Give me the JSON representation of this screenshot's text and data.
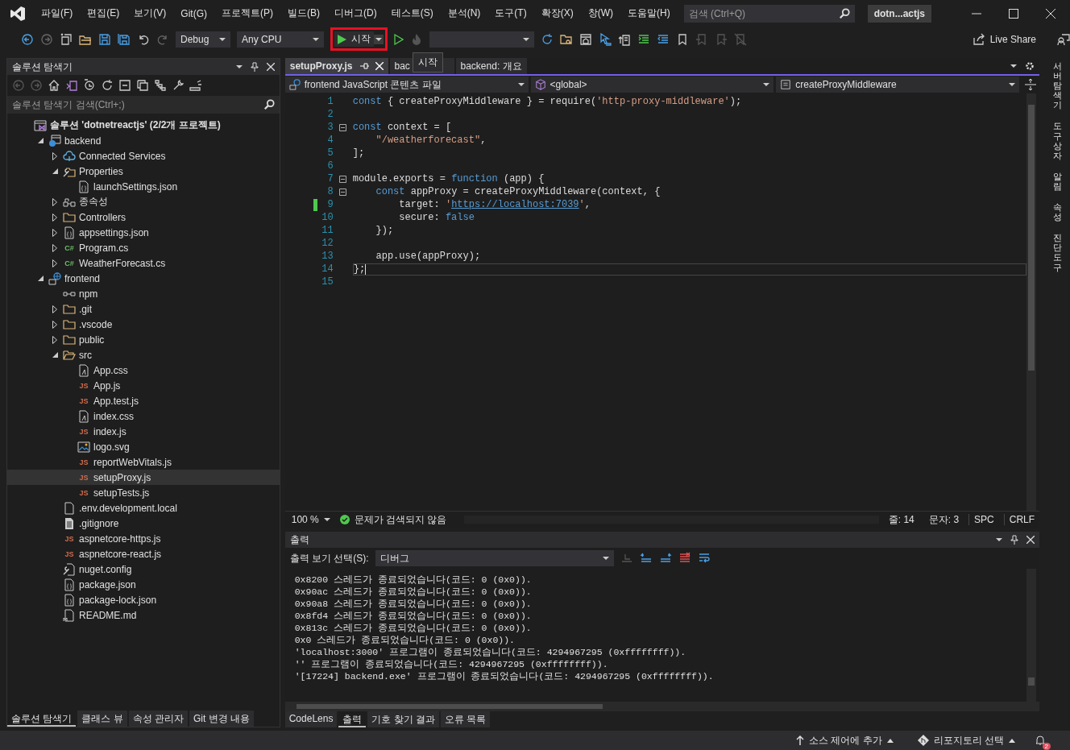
{
  "menu": [
    "파일(F)",
    "편집(E)",
    "보기(V)",
    "Git(G)",
    "프로젝트(P)",
    "빌드(B)",
    "디버그(D)",
    "테스트(S)",
    "분석(N)",
    "도구(T)",
    "확장(X)",
    "창(W)",
    "도움말(H)"
  ],
  "search": {
    "placeholder": "검색 (Ctrl+Q)"
  },
  "solution_name": "dotn...actjs",
  "toolbar": {
    "configuration": "Debug",
    "platform": "Any CPU",
    "start": {
      "label": "시작",
      "highlighted": true
    },
    "live_share": "Live Share"
  },
  "tooltip": "시작",
  "solution_explorer": {
    "title": "솔루션 탐색기",
    "search": {
      "placeholder": "솔루션 탐색기 검색(Ctrl+;)"
    },
    "tree": [
      {
        "label": "솔루션 'dotnetreactjs' (2/2개 프로젝트)",
        "kind": "solution",
        "bold": true,
        "selected": false,
        "children": [
          {
            "label": "backend",
            "kind": "project",
            "expanded": true,
            "selected": false,
            "children": [
              {
                "label": "Connected Services",
                "kind": "cloud",
                "expanded": false,
                "selected": false
              },
              {
                "label": "Properties",
                "kind": "properties",
                "expanded": true,
                "selected": false,
                "children": [
                  {
                    "label": "launchSettings.json",
                    "kind": "json",
                    "selected": false
                  }
                ]
              },
              {
                "label": "종속성",
                "kind": "deps",
                "expanded": false,
                "selected": false
              },
              {
                "label": "Controllers",
                "kind": "folder",
                "expanded": false,
                "selected": false
              },
              {
                "label": "appsettings.json",
                "kind": "json",
                "expanded": false,
                "selected": false
              },
              {
                "label": "Program.cs",
                "kind": "code",
                "badge": "C#",
                "expanded": false,
                "selected": false
              },
              {
                "label": "WeatherForecast.cs",
                "kind": "code",
                "badge": "C#",
                "expanded": false,
                "selected": false
              }
            ]
          },
          {
            "label": "frontend",
            "kind": "web",
            "expanded": true,
            "selected": false,
            "children": [
              {
                "label": "npm",
                "kind": "npm",
                "selected": false
              },
              {
                "label": ".git",
                "kind": "folder",
                "expanded": false,
                "selected": false
              },
              {
                "label": ".vscode",
                "kind": "folder",
                "expanded": false,
                "selected": false
              },
              {
                "label": "public",
                "kind": "folder",
                "expanded": false,
                "selected": false
              },
              {
                "label": "src",
                "kind": "folder",
                "expanded": true,
                "selected": false,
                "children": [
                  {
                    "label": "App.css",
                    "kind": "css",
                    "selected": false
                  },
                  {
                    "label": "App.js",
                    "kind": "code",
                    "badge": "JS",
                    "selected": false
                  },
                  {
                    "label": "App.test.js",
                    "kind": "code",
                    "badge": "JS",
                    "selected": false
                  },
                  {
                    "label": "index.css",
                    "kind": "css",
                    "selected": false
                  },
                  {
                    "label": "index.js",
                    "kind": "code",
                    "badge": "JS",
                    "selected": false
                  },
                  {
                    "label": "logo.svg",
                    "kind": "image",
                    "selected": false
                  },
                  {
                    "label": "reportWebVitals.js",
                    "kind": "code",
                    "badge": "JS",
                    "selected": false
                  },
                  {
                    "label": "setupProxy.js",
                    "kind": "code",
                    "badge": "JS",
                    "selected": true
                  },
                  {
                    "label": "setupTests.js",
                    "kind": "code",
                    "badge": "JS",
                    "selected": false
                  }
                ]
              },
              {
                "label": ".env.development.local",
                "kind": "file",
                "selected": false
              },
              {
                "label": ".gitignore",
                "kind": "text",
                "selected": false
              },
              {
                "label": "aspnetcore-https.js",
                "kind": "code",
                "badge": "JS",
                "selected": false
              },
              {
                "label": "aspnetcore-react.js",
                "kind": "code",
                "badge": "JS",
                "selected": false
              },
              {
                "label": "nuget.config",
                "kind": "config",
                "selected": false
              },
              {
                "label": "package.json",
                "kind": "json",
                "selected": false
              },
              {
                "label": "package-lock.json",
                "kind": "json",
                "selected": false
              },
              {
                "label": "README.md",
                "kind": "markdown",
                "selected": false
              }
            ]
          }
        ]
      }
    ],
    "tabs": [
      {
        "label": "솔루션 탐색기",
        "selected": true
      },
      {
        "label": "클래스 뷰",
        "selected": false
      },
      {
        "label": "속성 관리자",
        "selected": false
      },
      {
        "label": "Git 변경 내용",
        "selected": false
      }
    ]
  },
  "editor": {
    "tabs": [
      {
        "label": "setupProxy.js",
        "selected": true
      },
      {
        "label": "bac",
        "selected": false
      },
      {
        "label": "backend: 개요",
        "selected": false
      }
    ],
    "nav": [
      "frontend JavaScript 콘텐츠 파일",
      "<global>",
      "createProxyMiddleware"
    ],
    "lines": [
      {
        "number": "1",
        "tokens": [
          {
            "kind": "kw",
            "text": "const"
          },
          {
            "kind": "plain",
            "text": " { createProxyMiddleware } = require("
          },
          {
            "kind": "str",
            "text": "'http-proxy-middleware'"
          },
          {
            "kind": "plain",
            "text": ");"
          }
        ]
      },
      {
        "number": "2"
      },
      {
        "number": "3",
        "fold": true,
        "tokens": [
          {
            "kind": "kw",
            "text": "const"
          },
          {
            "kind": "plain",
            "text": " context = ["
          }
        ]
      },
      {
        "number": "4",
        "tokens": [
          {
            "kind": "str",
            "text": "    \"/weatherforecast\""
          },
          {
            "kind": "plain",
            "text": ","
          }
        ]
      },
      {
        "number": "5",
        "tokens": [
          {
            "kind": "plain",
            "text": "];"
          }
        ]
      },
      {
        "number": "6"
      },
      {
        "number": "7",
        "fold": true,
        "tokens": [
          {
            "kind": "plain",
            "text": "module.exports = "
          },
          {
            "kind": "kw",
            "text": "function"
          },
          {
            "kind": "plain",
            "text": " (app) {"
          }
        ]
      },
      {
        "number": "8",
        "fold": true,
        "tokens": [
          {
            "kind": "kw",
            "text": "    const"
          },
          {
            "kind": "plain",
            "text": " appProxy = createProxyMiddleware(context, {"
          }
        ]
      },
      {
        "number": "9",
        "changed": true,
        "tokens": [
          {
            "kind": "plain",
            "text": "        target: "
          },
          {
            "kind": "str",
            "text": "'"
          },
          {
            "kind": "link",
            "text": "https://localhost:7039"
          },
          {
            "kind": "str",
            "text": "'"
          },
          {
            "kind": "plain",
            "text": ","
          }
        ]
      },
      {
        "number": "10",
        "tokens": [
          {
            "kind": "plain",
            "text": "        secure: "
          },
          {
            "kind": "kw",
            "text": "false"
          }
        ]
      },
      {
        "number": "11",
        "tokens": [
          {
            "kind": "plain",
            "text": "    });"
          }
        ]
      },
      {
        "number": "12"
      },
      {
        "number": "13",
        "tokens": [
          {
            "kind": "plain",
            "text": "    app.use(appProxy);"
          }
        ]
      },
      {
        "number": "14",
        "current": true,
        "tokens": [
          {
            "kind": "plain",
            "text": "};"
          }
        ]
      },
      {
        "number": "15"
      }
    ],
    "zoom": "100 %",
    "issues": "문제가 검색되지 않음",
    "line": "줄: 14",
    "column": "문자: 3",
    "whitespace": "SPC",
    "line_ending": "CRLF"
  },
  "output": {
    "title": "출력",
    "source_label": "출력 보기 선택(S):",
    "source": "디버그",
    "lines": [
      "0x8200 스레드가 종료되었습니다(코드: 0 (0x0)).",
      "0x90ac 스레드가 종료되었습니다(코드: 0 (0x0)).",
      "0x90a8 스레드가 종료되었습니다(코드: 0 (0x0)).",
      "0x8fd4 스레드가 종료되었습니다(코드: 0 (0x0)).",
      "0x813c 스레드가 종료되었습니다(코드: 0 (0x0)).",
      "0x0 스레드가 종료되었습니다(코드: 0 (0x0)).",
      "'localhost:3000' 프로그램이 종료되었습니다(코드: 4294967295 (0xffffffff)).",
      "'' 프로그램이 종료되었습니다(코드: 4294967295 (0xffffffff)).",
      "'[17224] backend.exe' 프로그램이 종료되었습니다(코드: 4294967295 (0xffffffff))."
    ]
  },
  "bottom_tabs": [
    {
      "label": "CodeLens",
      "selected": false
    },
    {
      "label": "출력",
      "selected": true
    },
    {
      "label": "기호 찾기 결과",
      "selected": false
    },
    {
      "label": "오류 목록",
      "selected": false
    }
  ],
  "side_tabs": [
    "서버 탐색기",
    "도구 상자",
    "알림",
    "속성",
    "진단 도구"
  ],
  "status_bar": {
    "source_control": "소스 제어에 추가",
    "repository": "리포지토리 선택",
    "notifications": "2"
  }
}
